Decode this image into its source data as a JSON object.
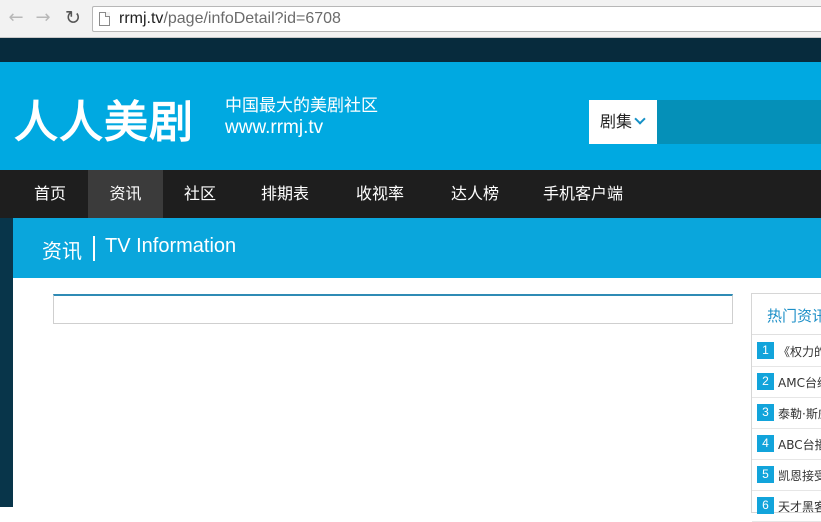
{
  "browser": {
    "back_icon": "←",
    "forward_icon": "→",
    "reload_icon": "↻",
    "url_host": "rrmj.tv",
    "url_path": "/page/infoDetail?id=6708"
  },
  "header": {
    "logo": "人人美剧",
    "tagline": "中国最大的美剧社区",
    "site_url": "www.rrmj.tv",
    "search_category": "剧集",
    "search_value": ""
  },
  "nav": {
    "items": [
      {
        "label": "首页"
      },
      {
        "label": "资讯",
        "active": true
      },
      {
        "label": "社区"
      },
      {
        "label": "排期表"
      },
      {
        "label": "收视率"
      },
      {
        "label": "达人榜"
      },
      {
        "label": "手机客户端"
      }
    ]
  },
  "section": {
    "title": "资讯",
    "subtitle": "TV Information"
  },
  "sidebar": {
    "title": "热门资讯",
    "items": [
      {
        "num": "1",
        "text": "《权力的"
      },
      {
        "num": "2",
        "text": "AMC台续"
      },
      {
        "num": "3",
        "text": "泰勒·斯威"
      },
      {
        "num": "4",
        "text": "ABC台播"
      },
      {
        "num": "5",
        "text": "凯恩接受"
      },
      {
        "num": "6",
        "text": "天才黑客"
      }
    ]
  },
  "colors": {
    "brand_blue": "#00a9e1",
    "nav_dark": "#1e1e1e",
    "top_strip": "#072b3d",
    "accent_number": "#12a4db"
  }
}
